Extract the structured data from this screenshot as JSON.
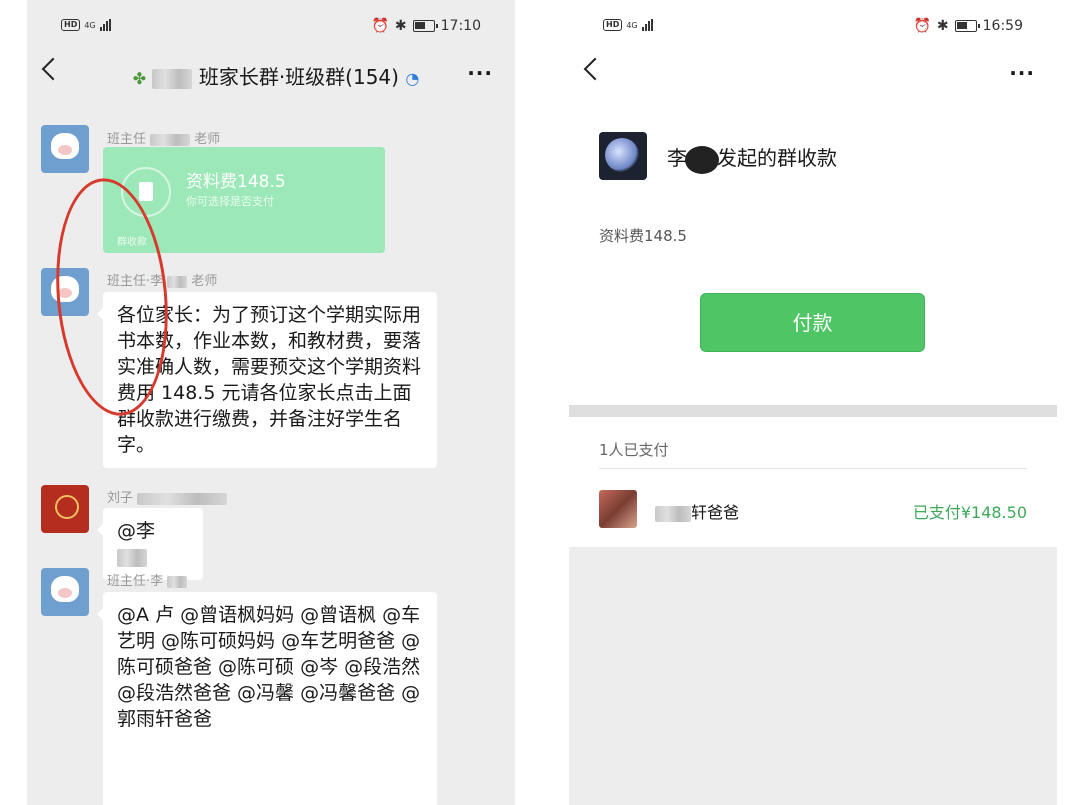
{
  "left": {
    "status": {
      "time": "17:10",
      "network": "4G"
    },
    "title": "班家长群·班级群(154)",
    "messages": {
      "m1": {
        "sender": "班主任",
        "sender_suffix": "老师"
      },
      "card": {
        "title": "资料费148.5",
        "subtitle": "你可选择是否支付",
        "footer": "群收款"
      },
      "m2": {
        "sender": "班主任·李",
        "sender_suffix": "老师",
        "text": "各位家长：为了预订这个学期实际用书本数，作业本数，和教材费，要落实准确人数，需要预交这个学期资料费用 148.5 元请各位家长点击上面群收款进行缴费，并备注好学生名字。"
      },
      "m3": {
        "sender": "刘子",
        "text": "@李"
      },
      "m4": {
        "sender": "班主任·李",
        "sender_suffix": "老师",
        "text": "@A 卢        @曾语枫妈妈         @曾语枫 @车艺明           @陈可硕妈妈 @车艺明爸爸 @陈可硕爸爸 @陈可硕 @岑 @段浩然           @段浩然爸爸 @冯馨           @冯馨爸爸           @郭雨轩爸爸"
      }
    }
  },
  "right": {
    "status": {
      "time": "16:59",
      "network": "4G"
    },
    "title_prefix": "李",
    "title_suffix": "发起的群收款",
    "item": "资料费148.5",
    "pay_button": "付款",
    "paid_count": "1人已支付",
    "payer": {
      "name": "轩爸爸",
      "amount": "已支付¥148.50"
    }
  },
  "colors": {
    "wechat_green": "#4fc565",
    "card_green": "#9de8b8",
    "annotation_red": "#d63a2c",
    "paid_green": "#3daa5a"
  }
}
